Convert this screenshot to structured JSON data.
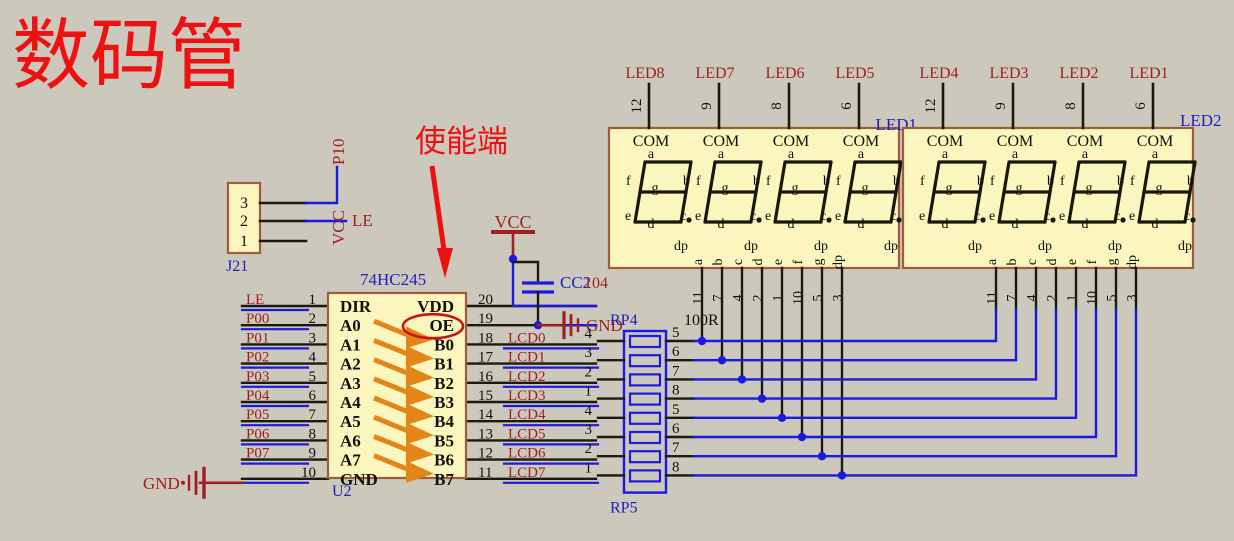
{
  "page": {
    "title": "数码管",
    "title_color": "#ee1111",
    "background": "#cdc8bc"
  },
  "annotation": {
    "label": "使能端",
    "color": "#ee1111",
    "points_to": "OE"
  },
  "colors": {
    "wire_blue": "#1a1ae0",
    "wire_black": "#1a1a10",
    "net_label_red": "#9e2020",
    "designator_blue": "#2020c0",
    "body_fill": "#fbf6bd",
    "body_stroke": "#a05a3c",
    "arrow_orange": "#e2861a",
    "oe_circle": "#cc1111",
    "pin_number": "#111108",
    "junction": "#1a1ae0"
  },
  "connector": {
    "designator": "J21",
    "pins": [
      {
        "number": "3",
        "net": "P10"
      },
      {
        "number": "2",
        "net": "LE"
      },
      {
        "number": "1",
        "net": "VCC"
      }
    ]
  },
  "chip": {
    "part": "74HC245",
    "designator": "U2",
    "left_pins": [
      {
        "number": "1",
        "name": "DIR",
        "net": "LE"
      },
      {
        "number": "2",
        "name": "A0",
        "net": "P00"
      },
      {
        "number": "3",
        "name": "A1",
        "net": "P01"
      },
      {
        "number": "4",
        "name": "A2",
        "net": "P02"
      },
      {
        "number": "5",
        "name": "A3",
        "net": "P03"
      },
      {
        "number": "6",
        "name": "A4",
        "net": "P04"
      },
      {
        "number": "7",
        "name": "A5",
        "net": "P05"
      },
      {
        "number": "8",
        "name": "A6",
        "net": "P06"
      },
      {
        "number": "9",
        "name": "A7",
        "net": "P07"
      },
      {
        "number": "10",
        "name": "GND",
        "net": "GND"
      }
    ],
    "right_pins": [
      {
        "number": "20",
        "name": "VDD",
        "net": "VCC"
      },
      {
        "number": "19",
        "name": "OE",
        "net": "GND"
      },
      {
        "number": "18",
        "name": "B0",
        "net": "LCD0"
      },
      {
        "number": "17",
        "name": "B1",
        "net": "LCD1"
      },
      {
        "number": "16",
        "name": "B2",
        "net": "LCD2"
      },
      {
        "number": "15",
        "name": "B3",
        "net": "LCD3"
      },
      {
        "number": "14",
        "name": "B4",
        "net": "LCD4"
      },
      {
        "number": "13",
        "name": "B5",
        "net": "LCD5"
      },
      {
        "number": "12",
        "name": "B6",
        "net": "LCD6"
      },
      {
        "number": "11",
        "name": "B7",
        "net": "LCD7"
      }
    ]
  },
  "capacitor": {
    "designator": "CC2",
    "value": "104",
    "top_net": "VCC",
    "bottom_net": "GND"
  },
  "resistor_packs": [
    {
      "designator": "RP4",
      "value": "100R",
      "rows": [
        {
          "left_pin": "4",
          "left_net": "LCD0",
          "right_pin": "5"
        },
        {
          "left_pin": "3",
          "left_net": "LCD1",
          "right_pin": "6"
        },
        {
          "left_pin": "2",
          "left_net": "LCD2",
          "right_pin": "7"
        },
        {
          "left_pin": "1",
          "left_net": "LCD3",
          "right_pin": "8"
        }
      ]
    },
    {
      "designator": "RP5",
      "value": "",
      "rows": [
        {
          "left_pin": "4",
          "left_net": "LCD4",
          "right_pin": "5"
        },
        {
          "left_pin": "3",
          "left_net": "LCD5",
          "right_pin": "6"
        },
        {
          "left_pin": "2",
          "left_net": "LCD6",
          "right_pin": "7"
        },
        {
          "left_pin": "1",
          "left_net": "LCD7",
          "right_pin": "8"
        }
      ]
    }
  ],
  "display_modules": [
    {
      "designator": "LED1",
      "digits": [
        {
          "label": "LED8",
          "com_pin": "12"
        },
        {
          "label": "LED7",
          "com_pin": "9"
        },
        {
          "label": "LED6",
          "com_pin": "8"
        },
        {
          "label": "LED5",
          "com_pin": "6"
        }
      ],
      "segment_pins": [
        {
          "seg": "a",
          "pin": "11"
        },
        {
          "seg": "b",
          "pin": "7"
        },
        {
          "seg": "c",
          "pin": "4"
        },
        {
          "seg": "d",
          "pin": "2"
        },
        {
          "seg": "e",
          "pin": "1"
        },
        {
          "seg": "f",
          "pin": "10"
        },
        {
          "seg": "g",
          "pin": "5"
        },
        {
          "seg": "dp",
          "pin": "3"
        }
      ]
    },
    {
      "designator": "LED2",
      "digits": [
        {
          "label": "LED4",
          "com_pin": "12"
        },
        {
          "label": "LED3",
          "com_pin": "9"
        },
        {
          "label": "LED2",
          "com_pin": "8"
        },
        {
          "label": "LED1",
          "com_pin": "6"
        }
      ],
      "segment_pins": [
        {
          "seg": "a",
          "pin": "11"
        },
        {
          "seg": "b",
          "pin": "7"
        },
        {
          "seg": "c",
          "pin": "4"
        },
        {
          "seg": "d",
          "pin": "2"
        },
        {
          "seg": "e",
          "pin": "1"
        },
        {
          "seg": "f",
          "pin": "10"
        },
        {
          "seg": "g",
          "pin": "5"
        },
        {
          "seg": "dp",
          "pin": "3"
        }
      ]
    }
  ],
  "segment_labels": {
    "com": "COM",
    "a": "a",
    "b": "b",
    "c": "c",
    "d": "d",
    "e": "e",
    "f": "f",
    "g": "g",
    "dp": "dp"
  },
  "power_nets": {
    "vcc": "VCC",
    "gnd": "GND"
  }
}
